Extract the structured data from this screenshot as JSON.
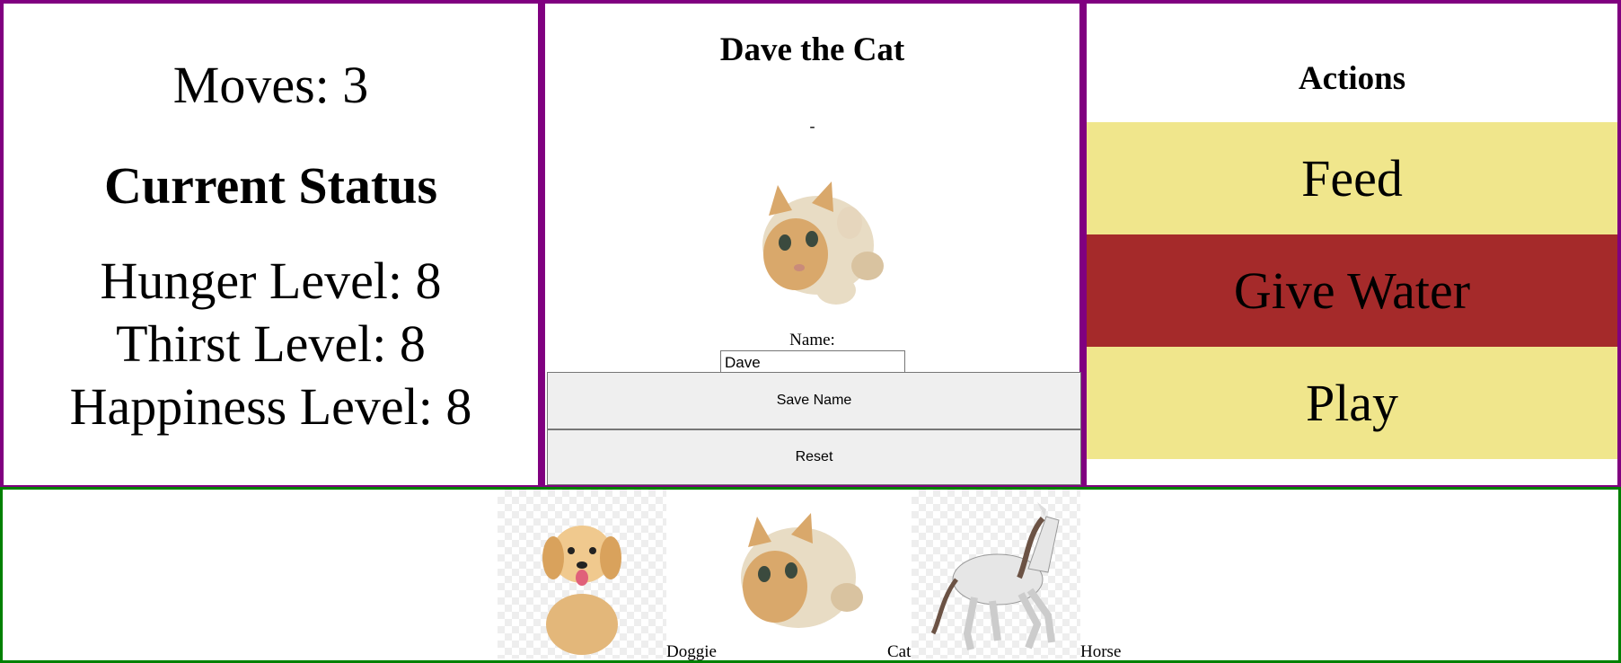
{
  "status": {
    "moves_label": "Moves: 3",
    "title": "Current Status",
    "hunger": "Hunger Level: 8",
    "thirst": "Thirst Level: 8",
    "happiness": "Happiness Level: 8"
  },
  "pet": {
    "title": "Dave the Cat",
    "dash": "-",
    "name_label": "Name:",
    "name_value": "Dave",
    "save_label": "Save Name",
    "reset_label": "Reset"
  },
  "actions": {
    "title": "Actions",
    "feed": "Feed",
    "water": "Give Water",
    "play": "Play"
  },
  "choices": [
    {
      "label": "Doggie"
    },
    {
      "label": "Cat"
    },
    {
      "label": "Horse"
    }
  ],
  "colors": {
    "panel_border": "#800080",
    "choices_border": "#008000",
    "khaki": "#f0e68c",
    "brown": "#a52a2a"
  }
}
